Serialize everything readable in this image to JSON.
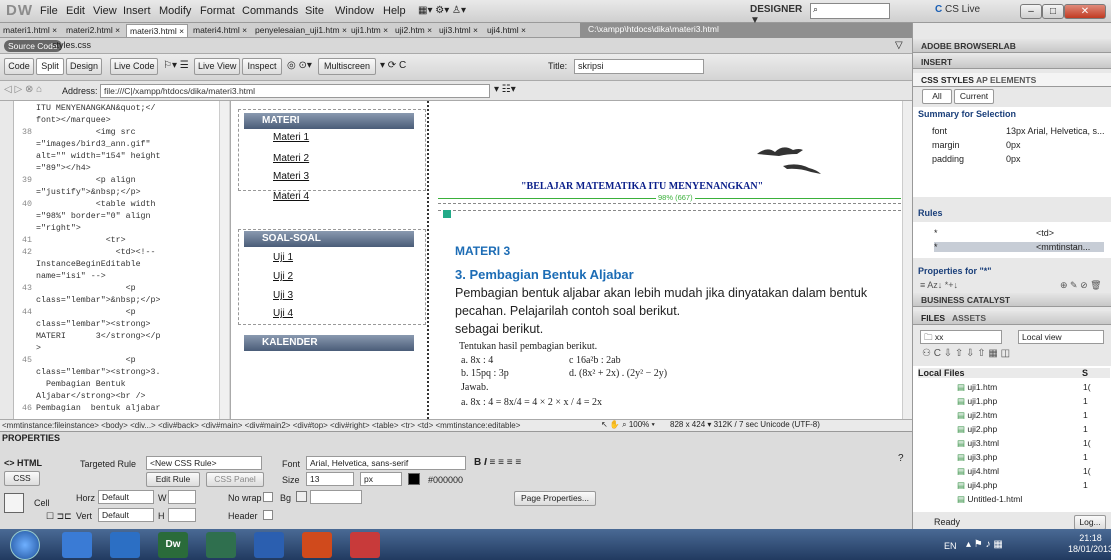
{
  "app": {
    "logo": "DW",
    "menu": [
      "File",
      "Edit",
      "View",
      "Insert",
      "Modify",
      "Format",
      "Commands",
      "Site",
      "Window",
      "Help"
    ],
    "workspace": "DESIGNER ▼",
    "cs_live": "CS Live"
  },
  "tabs": [
    "materi1.html ×",
    "materi2.html ×",
    "materi3.html ×",
    "materi4.html ×",
    "penyelesaian_uji1.htm ×",
    "uji1.htm ×",
    "uji2.htm ×",
    "uji3.html ×",
    "uji4.html ×"
  ],
  "file_path": "C:\\xampp\\htdocs\\dika\\materi3.html",
  "source": {
    "button": "Source Code",
    "file": "styles.css"
  },
  "toolbar": {
    "code": "Code",
    "split": "Split",
    "design": "Design",
    "live_code": "Live Code",
    "live_view": "Live View",
    "inspect": "Inspect",
    "multiscreen": "Multiscreen",
    "title_label": "Title:",
    "title_value": "skripsi"
  },
  "address": {
    "label": "Address:",
    "value": "file:///C|/xampp/htdocs/dika/materi3.html"
  },
  "code_lines": [
    {
      "n": "",
      "t": "ITU MENYENANGKAN&quot;</"
    },
    {
      "n": "",
      "t": "font></marquee>"
    },
    {
      "n": "38",
      "t": "            <img src"
    },
    {
      "n": "",
      "t": "=\"images/bird3_ann.gif\""
    },
    {
      "n": "",
      "t": "alt=\"\" width=\"154\" height"
    },
    {
      "n": "",
      "t": "=\"89\"></h4>"
    },
    {
      "n": "39",
      "t": "            <p align"
    },
    {
      "n": "",
      "t": "=\"justify\">&nbsp;</p>"
    },
    {
      "n": "40",
      "t": "            <table width"
    },
    {
      "n": "",
      "t": "=\"98%\" border=\"0\" align"
    },
    {
      "n": "",
      "t": "=\"right\">"
    },
    {
      "n": "41",
      "t": "              <tr>"
    },
    {
      "n": "42",
      "t": "                <td><!--"
    },
    {
      "n": "",
      "t": "InstanceBeginEditable"
    },
    {
      "n": "",
      "t": "name=\"isi\" -->"
    },
    {
      "n": "43",
      "t": "                  <p"
    },
    {
      "n": "",
      "t": "class=\"lembar\">&nbsp;</p>"
    },
    {
      "n": "44",
      "t": "                  <p"
    },
    {
      "n": "",
      "t": "class=\"lembar\"><strong>"
    },
    {
      "n": "",
      "t": "MATERI      3</strong></p"
    },
    {
      "n": "",
      "t": ">"
    },
    {
      "n": "45",
      "t": "                  <p"
    },
    {
      "n": "",
      "t": "class=\"lembar\"><strong>3."
    },
    {
      "n": "",
      "t": "  Pembagian Bentuk"
    },
    {
      "n": "",
      "t": "Aljabar</strong><br />"
    },
    {
      "n": "46",
      "t": "Pembagian  bentuk aljabar"
    }
  ],
  "sidebar": {
    "materi_head": "MATERI",
    "materi_links": [
      "Materi 1",
      "Materi 2",
      "Materi 3",
      "Materi 4"
    ],
    "soal_head": "SOAL-SOAL",
    "soal_links": [
      "Uji 1",
      "Uji 2",
      "Uji 3",
      "Uji 4"
    ],
    "kalender_head": "KALENDER"
  },
  "page": {
    "marquee": "\"BELAJAR MATEMATIKA ITU MENYENANGKAN\"",
    "width_label": "98% (667)",
    "heading": "MATERI 3",
    "subheading": "3. Pembagian Bentuk Aljabar",
    "para1": "Pembagian bentuk aljabar akan lebih mudah jika dinyatakan dalam bentuk",
    "para2": "pecahan. Pelajarilah contoh soal berikut.",
    "para3": "sebagai berikut.",
    "ex_title": "Tentukan hasil pembagian berikut.",
    "ex_a": "a.   8x : 4",
    "ex_c": "c   16a²b : 2ab",
    "ex_b": "b.   15pq : 3p",
    "ex_d": "d.   (8x² + 2x) . (2y² − 2y)",
    "jawab": "Jawab.",
    "answer": "a.   8x : 4 = 8x/4 = 4 × 2 × x / 4 = 2x"
  },
  "statusbar": {
    "tags": "<mmtinstance:fileinstance> <body> <div...> <div#back> <div#main> <div#main2> <div#top> <div#right> <table> <tr> <td> <mmtinstance:editable>",
    "zoom": "100%",
    "size": "828 x 424 ▾ 312K / 7 sec  Unicode (UTF-8)"
  },
  "properties": {
    "title": "PROPERTIES",
    "html": "HTML",
    "css": "CSS",
    "targeted_label": "Targeted Rule",
    "targeted_value": "<New CSS Rule>",
    "edit_rule": "Edit Rule",
    "css_panel": "CSS Panel",
    "font_label": "Font",
    "font_value": "Arial, Helvetica, sans-serif",
    "size_label": "Size",
    "size_value": "13",
    "unit": "px",
    "color": "#000000",
    "cell": "Cell",
    "horz": "Horz",
    "horz_value": "Default",
    "vert": "Vert",
    "vert_value": "Default",
    "w": "W",
    "h": "H",
    "nowrap": "No wrap",
    "bg": "Bg",
    "header": "Header",
    "page_props": "Page Properties..."
  },
  "panels": {
    "adobe_browserlab": "ADOBE BROWSERLAB",
    "insert": "INSERT",
    "css_styles": "CSS STYLES",
    "ap_elements": "AP ELEMENTS",
    "all": "All",
    "current": "Current",
    "summary": "Summary for Selection",
    "props": [
      {
        "k": "font",
        "v": "13px Arial, Helvetica, s..."
      },
      {
        "k": "margin",
        "v": "0px"
      },
      {
        "k": "padding",
        "v": "0px"
      }
    ],
    "rules": "Rules",
    "rule_rows": [
      {
        "k": "*",
        "v": "<td>"
      },
      {
        "k": "*",
        "v": "<mmtinstan..."
      }
    ],
    "properties_for": "Properties for \"*\"",
    "business_catalyst": "BUSINESS CATALYST",
    "files": "FILES",
    "assets": "ASSETS",
    "site": "xx",
    "view": "Local view",
    "local_files": "Local Files",
    "s_col": "S",
    "files_list": [
      {
        "name": "uji1.htm",
        "s": "1("
      },
      {
        "name": "uji1.php",
        "s": "1"
      },
      {
        "name": "uji2.htm",
        "s": "1"
      },
      {
        "name": "uji2.php",
        "s": "1"
      },
      {
        "name": "uji3.html",
        "s": "1("
      },
      {
        "name": "uji3.php",
        "s": "1"
      },
      {
        "name": "uji4.html",
        "s": "1("
      },
      {
        "name": "uji4.php",
        "s": "1"
      },
      {
        "name": "Untitled-1.html",
        "s": ""
      }
    ],
    "ready": "Ready",
    "log": "Log..."
  },
  "taskbar": {
    "lang": "EN",
    "time": "21:18",
    "date": "18/01/2013"
  },
  "colors": {
    "accent": "#1a5fb4",
    "marquee": "#0a1f8a",
    "heading": "#1c6cb5"
  }
}
